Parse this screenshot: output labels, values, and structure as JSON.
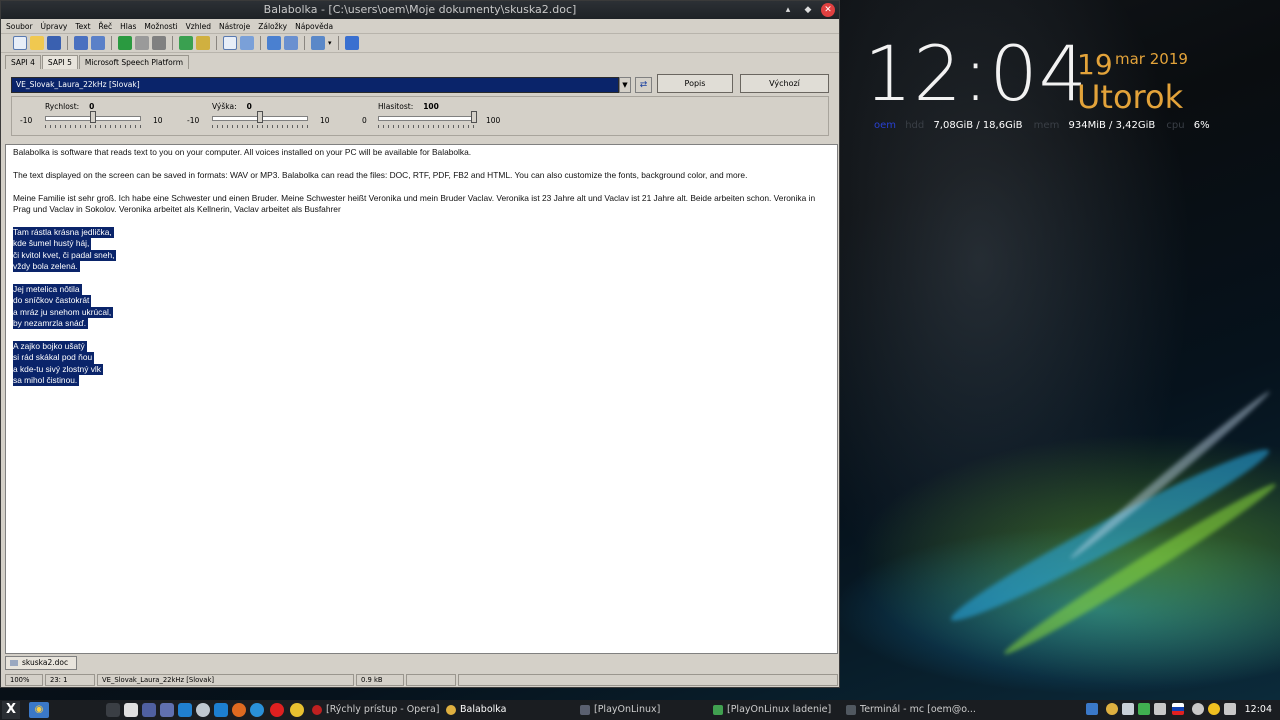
{
  "window": {
    "title": "Balabolka - [C:\\users\\oem\\Moje dokumenty\\skuska2.doc]",
    "controls": [
      "▴",
      "◆",
      "✕"
    ]
  },
  "menu": [
    "Soubor",
    "Úpravy",
    "Text",
    "Řeč",
    "Hlas",
    "Možnosti",
    "Vzhled",
    "Nástroje",
    "Záložky",
    "Nápověda"
  ],
  "tabs": [
    "SAPI 4",
    "SAPI 5",
    "Microsoft Speech Platform"
  ],
  "voice": {
    "selected": "VE_Slovak_Laura_22kHz [Slovak]",
    "describe_label": "Popis",
    "default_label": "Výchozí"
  },
  "sliders": {
    "rate": {
      "label": "Rychlost:",
      "value": "0",
      "min": "-10",
      "max": "10",
      "level": 0.5
    },
    "pitch": {
      "label": "Výška:",
      "value": "0",
      "min": "-10",
      "max": "10",
      "level": 0.5
    },
    "volume": {
      "label": "Hlasitost:",
      "value": "100",
      "min": "0",
      "max": "100",
      "level": 1.0
    }
  },
  "document": {
    "p1": "Balabolka is software that reads text to you on your computer. All voices installed on your PC will be available for Balabolka.",
    "p2": "The text displayed on the screen can be saved in formats: WAV or MP3. Balabolka can read the files: DOC, RTF, PDF, FB2 and HTML. You can also customize the fonts, background color, and more.",
    "p3": "Meine Familie ist sehr groß. Ich habe eine Schwester und einen Bruder. Meine Schwester heißt Veronika und mein Bruder Vaclav. Veronika ist 23 Jahre alt und Vaclav ist 21 Jahre alt. Beide arbeiten schon. Veronika in Prag und Vaclav in Sokolov. Veronika arbeitet als Kellnerin, Vaclav arbeitet als Busfahrer",
    "poem1": [
      "Tam rástla krásna jedlička,",
      "kde šumel hustý háj,",
      "či kvitol kvet, či padal sneh,",
      "vždy bola zelená."
    ],
    "poem2": [
      "Jej metelica nôtila",
      "do sníčkov častokrát",
      "a mráz ju snehom ukrúcal,",
      "by nezamrzla snáď."
    ],
    "poem3": [
      "A zajko bojko ušatý",
      "si rád skákal pod ňou",
      "a kde-tu sivý zlostný vlk",
      "sa mihol čistinou."
    ]
  },
  "doc_tab": "skuska2.doc",
  "status": {
    "zoom": "100%",
    "position": "23:   1",
    "voice": "VE_Slovak_Laura_22kHz [Slovak]",
    "size": "0.9 kB"
  },
  "desktop": {
    "time": "12:04",
    "day": "19",
    "month_year": "mar 2019",
    "weekday": "Utorok",
    "stats": {
      "user_label": "oem",
      "hdd_label": "hdd",
      "hdd_value": "7,08GiB / 18,6GiB",
      "mem_label": "mem",
      "mem_value": "934MiB / 3,42GiB",
      "cpu_label": "cpu",
      "cpu_value": "6%"
    }
  },
  "taskbar": {
    "start": "X",
    "tasks": [
      "[Rýchly prístup - Opera]",
      "Balabolka",
      "[PlayOnLinux]",
      "[PlayOnLinux ladenie]",
      "Terminál - mc [oem@o..."
    ],
    "clock": "12:04"
  },
  "colors": {
    "accent_orange": "#e3a33a",
    "selection": "#0a246a",
    "window_bg": "#d4d0c8"
  }
}
